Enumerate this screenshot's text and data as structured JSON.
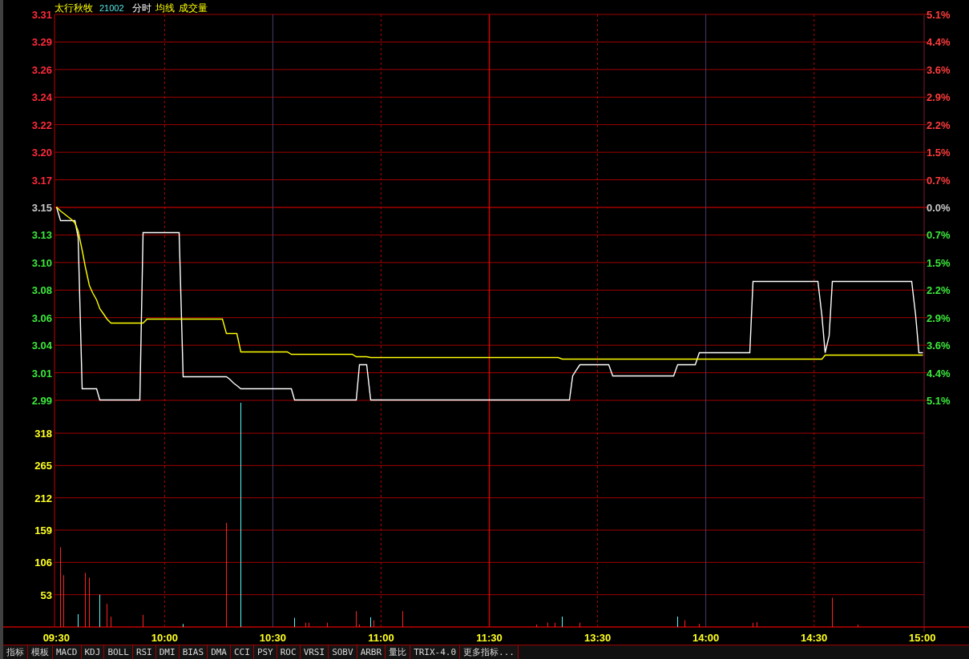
{
  "header": {
    "name": "太行秋牧",
    "code": "21002",
    "volume_label": "成交量"
  },
  "price_chart": {
    "chart_data": {
      "type": "line",
      "ylim": [
        2.99,
        3.31
      ],
      "categories": [
        null,
        null,
        null,
        null,
        null,
        null,
        null,
        null,
        null,
        null,
        null,
        null,
        null,
        null,
        null,
        null,
        null,
        null,
        null,
        null,
        null,
        null,
        null,
        null,
        null,
        null,
        null,
        null,
        null,
        null,
        null,
        null,
        null,
        null,
        null,
        null,
        null,
        null,
        null,
        null,
        null,
        null,
        null,
        null,
        null,
        null,
        null,
        null,
        null,
        null,
        null,
        null,
        null,
        null,
        null,
        null,
        null,
        null,
        null,
        null,
        null,
        null,
        null,
        null,
        null,
        null,
        null,
        null,
        null,
        null,
        null,
        null,
        null,
        null,
        null,
        null,
        null,
        null,
        null,
        null,
        null,
        null,
        null,
        null,
        null,
        null,
        null,
        null,
        null,
        null,
        null,
        null,
        null,
        null,
        null,
        null,
        null,
        null,
        null,
        null,
        null,
        null,
        null,
        null,
        null,
        null,
        null,
        null,
        null,
        null,
        null,
        null,
        null,
        null,
        null,
        null,
        null,
        null,
        null,
        null,
        null,
        null,
        null,
        null,
        null,
        null,
        null,
        null,
        null,
        null,
        null,
        null,
        null,
        null,
        null,
        null,
        null,
        null,
        null,
        null,
        null,
        null,
        null,
        null,
        null,
        null,
        null,
        null,
        null,
        null,
        null,
        null,
        null,
        null,
        null,
        null,
        null,
        null,
        null,
        null,
        null,
        null,
        null,
        null,
        null,
        null,
        null,
        null,
        null,
        null,
        null,
        null,
        null,
        null,
        null,
        null,
        null,
        null,
        null,
        null,
        null,
        null,
        null,
        null,
        null,
        null,
        null,
        null,
        null,
        null,
        null,
        null,
        null,
        null,
        null,
        null,
        null,
        null,
        null,
        null,
        null,
        null,
        null,
        null,
        null,
        null,
        null,
        null,
        null,
        null,
        null,
        null,
        null,
        null,
        null,
        null,
        null,
        null,
        null,
        null,
        null,
        null,
        null,
        null,
        null,
        null,
        null,
        null,
        null,
        null,
        null,
        null,
        null,
        null,
        null,
        null,
        null,
        null,
        null,
        null,
        null
      ],
      "yticks": [
        {
          "value": 3.31,
          "label": "3.31"
        },
        {
          "value": 3.2871,
          "label": "3.29"
        },
        {
          "value": 3.2643,
          "label": "3.26"
        },
        {
          "value": 3.2414,
          "label": "3.24"
        },
        {
          "value": 3.2186,
          "label": "3.22"
        },
        {
          "value": 3.1957,
          "label": "3.20"
        },
        {
          "value": 3.1729,
          "label": "3.17"
        },
        {
          "value": 3.15,
          "label": "3.15"
        },
        {
          "value": 3.1271,
          "label": "3.13"
        },
        {
          "value": 3.1043,
          "label": "3.10"
        },
        {
          "value": 3.0814,
          "label": "3.08"
        },
        {
          "value": 3.0586,
          "label": "3.06"
        },
        {
          "value": 3.0357,
          "label": "3.04"
        },
        {
          "value": 3.0129,
          "label": "3.01"
        },
        {
          "value": 2.99,
          "label": "2.99"
        }
      ],
      "series": [
        {
          "name": "分时",
          "color": "#ffffff",
          "values": [
            3.15,
            3.139,
            3.139,
            3.139,
            3.139,
            3.139,
            3.125,
            2.999,
            2.999,
            2.999,
            2.999,
            2.999,
            2.99,
            2.99,
            2.99,
            2.99,
            2.99,
            2.99,
            2.99,
            2.99,
            2.99,
            2.99,
            2.99,
            2.99,
            3.129,
            3.129,
            3.129,
            3.129,
            3.129,
            3.129,
            3.129,
            3.129,
            3.129,
            3.129,
            3.129,
            3.009,
            3.009,
            3.009,
            3.009,
            3.009,
            3.009,
            3.009,
            3.009,
            3.009,
            3.009,
            3.009,
            3.009,
            3.009,
            3.007,
            3.004,
            3.002,
            2.999,
            2.999,
            2.999,
            2.999,
            2.999,
            2.999,
            2.999,
            2.999,
            2.999,
            2.999,
            2.999,
            2.999,
            2.999,
            2.999,
            2.999,
            2.99,
            2.99,
            2.99,
            2.99,
            2.99,
            2.99,
            2.99,
            2.99,
            2.99,
            2.99,
            2.99,
            2.99,
            2.99,
            2.99,
            2.99,
            2.99,
            2.99,
            2.99,
            3.019,
            3.019,
            3.019,
            2.99,
            2.99,
            2.99,
            2.99,
            2.99,
            2.99,
            2.99,
            2.99,
            2.99,
            2.99,
            2.99,
            2.99,
            2.99,
            2.99,
            2.99,
            2.99,
            2.99,
            2.99,
            2.99,
            2.99,
            2.99,
            2.99,
            2.99,
            2.99,
            2.99,
            2.99,
            2.99,
            2.99,
            2.99,
            2.99,
            2.99,
            2.99,
            2.99,
            2.99,
            2.99,
            2.99,
            2.99,
            2.99,
            2.99,
            2.99,
            2.99,
            2.99,
            2.99,
            2.99,
            2.99,
            2.99,
            2.99,
            2.99,
            2.99,
            2.99,
            2.99,
            2.99,
            2.99,
            2.99,
            2.99,
            2.99,
            3.01,
            3.015,
            3.019,
            3.019,
            3.019,
            3.019,
            3.019,
            3.019,
            3.019,
            3.019,
            3.019,
            3.01,
            3.01,
            3.01,
            3.01,
            3.01,
            3.01,
            3.01,
            3.01,
            3.01,
            3.01,
            3.01,
            3.01,
            3.01,
            3.01,
            3.01,
            3.01,
            3.01,
            3.01,
            3.019,
            3.019,
            3.019,
            3.019,
            3.019,
            3.019,
            3.029,
            3.029,
            3.029,
            3.029,
            3.029,
            3.029,
            3.029,
            3.029,
            3.029,
            3.029,
            3.029,
            3.029,
            3.029,
            3.029,
            3.029,
            3.088,
            3.088,
            3.088,
            3.088,
            3.088,
            3.088,
            3.088,
            3.088,
            3.088,
            3.088,
            3.088,
            3.088,
            3.088,
            3.088,
            3.088,
            3.088,
            3.088,
            3.088,
            3.088,
            3.06,
            3.029,
            3.043,
            3.088,
            3.088,
            3.088,
            3.088,
            3.088,
            3.088,
            3.088,
            3.088,
            3.088,
            3.088,
            3.088,
            3.088,
            3.088,
            3.088,
            3.088,
            3.088,
            3.088,
            3.088,
            3.088,
            3.088,
            3.088,
            3.088,
            3.088,
            3.06,
            3.029,
            3.029
          ]
        },
        {
          "name": "均线",
          "color": "#ffff00",
          "values": [
            3.15,
            3.147,
            3.145,
            3.142,
            3.14,
            3.137,
            3.13,
            3.114,
            3.1,
            3.085,
            3.079,
            3.073,
            3.066,
            3.061,
            3.057,
            3.054,
            3.054,
            3.054,
            3.054,
            3.054,
            3.054,
            3.054,
            3.054,
            3.054,
            3.054,
            3.057,
            3.057,
            3.057,
            3.057,
            3.057,
            3.057,
            3.057,
            3.057,
            3.057,
            3.057,
            3.057,
            3.057,
            3.057,
            3.057,
            3.057,
            3.057,
            3.057,
            3.057,
            3.057,
            3.057,
            3.057,
            3.057,
            3.045,
            3.045,
            3.045,
            3.045,
            3.03,
            3.03,
            3.03,
            3.03,
            3.03,
            3.03,
            3.03,
            3.03,
            3.03,
            3.03,
            3.03,
            3.03,
            3.03,
            3.03,
            3.028,
            3.028,
            3.028,
            3.028,
            3.028,
            3.028,
            3.028,
            3.028,
            3.028,
            3.028,
            3.028,
            3.028,
            3.028,
            3.028,
            3.028,
            3.028,
            3.028,
            3.028,
            3.026,
            3.026,
            3.026,
            3.026,
            3.025,
            3.025,
            3.025,
            3.025,
            3.025,
            3.025,
            3.025,
            3.025,
            3.025,
            3.025,
            3.025,
            3.025,
            3.025,
            3.025,
            3.025,
            3.025,
            3.025,
            3.025,
            3.025,
            3.025,
            3.025,
            3.025,
            3.025,
            3.025,
            3.025,
            3.025,
            3.025,
            3.025,
            3.025,
            3.025,
            3.025,
            3.025,
            3.025,
            3.025,
            3.025,
            3.025,
            3.025,
            3.025,
            3.025,
            3.025,
            3.025,
            3.025,
            3.025,
            3.025,
            3.025,
            3.025,
            3.025,
            3.025,
            3.025,
            3.025,
            3.025,
            3.025,
            3.025,
            3.024,
            3.024,
            3.024,
            3.024,
            3.024,
            3.024,
            3.024,
            3.024,
            3.024,
            3.024,
            3.024,
            3.024,
            3.024,
            3.024,
            3.024,
            3.024,
            3.024,
            3.024,
            3.024,
            3.024,
            3.024,
            3.024,
            3.024,
            3.024,
            3.024,
            3.024,
            3.024,
            3.024,
            3.024,
            3.024,
            3.024,
            3.024,
            3.024,
            3.024,
            3.024,
            3.024,
            3.024,
            3.024,
            3.024,
            3.024,
            3.024,
            3.024,
            3.024,
            3.024,
            3.024,
            3.024,
            3.024,
            3.024,
            3.024,
            3.024,
            3.024,
            3.024,
            3.024,
            3.024,
            3.024,
            3.024,
            3.024,
            3.024,
            3.024,
            3.024,
            3.024,
            3.024,
            3.024,
            3.024,
            3.024,
            3.024,
            3.024,
            3.024,
            3.024,
            3.024,
            3.024,
            3.024,
            3.024,
            3.027,
            3.027,
            3.027,
            3.027,
            3.027,
            3.027,
            3.027,
            3.027,
            3.027,
            3.027,
            3.027,
            3.027,
            3.027,
            3.027,
            3.027,
            3.027,
            3.027,
            3.027,
            3.027,
            3.027,
            3.027,
            3.027,
            3.027,
            3.027,
            3.027,
            3.027,
            3.027,
            3.027
          ]
        }
      ]
    },
    "right_axis": [
      {
        "label": "5.1%",
        "color": "#ff3c3c"
      },
      {
        "label": "4.4%",
        "color": "#ff3c3c"
      },
      {
        "label": "3.6%",
        "color": "#ff3c3c"
      },
      {
        "label": "2.9%",
        "color": "#ff3c3c"
      },
      {
        "label": "2.2%",
        "color": "#ff3c3c"
      },
      {
        "label": "1.5%",
        "color": "#ff3c3c"
      },
      {
        "label": "0.7%",
        "color": "#ff3c3c"
      },
      {
        "label": "0.0%",
        "color": "#c8c8c8"
      },
      {
        "label": "0.7%",
        "color": "#3ce83c"
      },
      {
        "label": "1.5%",
        "color": "#3ce83c"
      },
      {
        "label": "2.2%",
        "color": "#3ce83c"
      },
      {
        "label": "2.9%",
        "color": "#3ce83c"
      },
      {
        "label": "3.6%",
        "color": "#3ce83c"
      },
      {
        "label": "4.4%",
        "color": "#3ce83c"
      },
      {
        "label": "5.1%",
        "color": "#3ce83c"
      }
    ]
  },
  "volume_chart": {
    "chart_data": {
      "type": "bar",
      "ylim": [
        0,
        368
      ],
      "yticks": [
        53,
        106,
        159,
        212,
        265,
        318
      ],
      "categories": [
        "09:30",
        null,
        null,
        null,
        null,
        null,
        null,
        null,
        null,
        null,
        null,
        null,
        null,
        null,
        null,
        null,
        null,
        null,
        null,
        null,
        null,
        null,
        null,
        null,
        null,
        null,
        null,
        null,
        null,
        null,
        "10:00",
        null,
        null,
        null,
        null,
        null,
        null,
        null,
        null,
        null,
        null,
        null,
        null,
        null,
        null,
        null,
        null,
        null,
        null,
        null,
        null,
        null,
        null,
        null,
        null,
        null,
        null,
        null,
        null,
        null,
        "10:30",
        null,
        null,
        null,
        null,
        null,
        null,
        null,
        null,
        null,
        null,
        null,
        null,
        null,
        null,
        null,
        null,
        null,
        null,
        null,
        null,
        null,
        null,
        null,
        null,
        null,
        null,
        null,
        null,
        null,
        "11:00",
        null,
        null,
        null,
        null,
        null,
        null,
        null,
        null,
        null,
        null,
        null,
        null,
        null,
        null,
        null,
        null,
        null,
        null,
        null,
        null,
        null,
        null,
        null,
        null,
        null,
        null,
        null,
        null,
        null,
        "11:30",
        null,
        null,
        null,
        null,
        null,
        null,
        null,
        null,
        null,
        null,
        null,
        null,
        null,
        null,
        null,
        null,
        null,
        null,
        null,
        null,
        null,
        null,
        null,
        null,
        null,
        null,
        null,
        null,
        null,
        "13:30",
        null,
        null,
        null,
        null,
        null,
        null,
        null,
        null,
        null,
        null,
        null,
        null,
        null,
        null,
        null,
        null,
        null,
        null,
        null,
        null,
        null,
        null,
        null,
        null,
        null,
        null,
        null,
        null,
        null,
        "14:00",
        null,
        null,
        null,
        null,
        null,
        null,
        null,
        null,
        null,
        null,
        null,
        null,
        null,
        null,
        null,
        null,
        null,
        null,
        null,
        null,
        null,
        null,
        null,
        null,
        null,
        null,
        null,
        null,
        null,
        "14:30",
        null,
        null,
        null,
        null,
        null,
        null,
        null,
        null,
        null,
        null,
        null,
        null,
        null,
        null,
        null,
        null,
        null,
        null,
        null,
        null,
        null,
        null,
        null,
        null,
        null,
        null,
        null,
        null,
        null,
        "15:00"
      ],
      "series": [
        {
          "color": "#ff2020",
          "values": [
            null,
            131,
            85,
            null,
            null,
            null,
            null,
            null,
            89,
            81,
            null,
            null,
            null,
            null,
            38,
            17,
            null,
            null,
            null,
            null,
            null,
            null,
            null,
            null,
            20,
            null,
            null,
            null,
            null,
            null,
            null,
            null,
            null,
            null,
            null,
            null,
            null,
            null,
            null,
            null,
            null,
            null,
            null,
            null,
            null,
            null,
            null,
            171,
            null,
            null,
            null,
            null,
            null,
            null,
            null,
            null,
            null,
            null,
            null,
            null,
            null,
            null,
            null,
            null,
            null,
            null,
            null,
            null,
            null,
            7,
            7,
            null,
            null,
            null,
            null,
            7,
            null,
            null,
            null,
            null,
            null,
            null,
            null,
            26,
            4,
            null,
            null,
            null,
            11,
            null,
            null,
            null,
            null,
            null,
            null,
            null,
            26,
            null,
            null,
            null,
            null,
            null,
            null,
            null,
            null,
            null,
            null,
            null,
            null,
            null,
            null,
            null,
            null,
            null,
            null,
            null,
            null,
            null,
            null,
            null,
            null,
            null,
            null,
            null,
            null,
            null,
            null,
            null,
            null,
            null,
            null,
            null,
            null,
            4,
            null,
            null,
            7,
            null,
            7,
            null,
            null,
            null,
            null,
            null,
            null,
            7,
            null,
            null,
            null,
            null,
            null,
            null,
            null,
            null,
            null,
            null,
            null,
            null,
            null,
            null,
            null,
            null,
            null,
            null,
            null,
            null,
            null,
            null,
            null,
            null,
            null,
            null,
            null,
            null,
            11,
            null,
            null,
            null,
            5,
            null,
            null,
            null,
            null,
            null,
            null,
            null,
            null,
            null,
            null,
            null,
            null,
            null,
            null,
            7,
            8,
            null,
            null,
            null,
            null,
            null,
            null,
            null,
            null,
            null,
            null,
            null,
            null,
            null,
            null,
            null,
            null,
            null,
            null,
            null,
            null,
            48,
            null,
            null,
            null,
            null,
            null,
            null,
            4,
            null,
            null,
            null,
            null,
            null,
            null,
            null,
            null,
            null,
            null,
            null,
            null,
            null,
            null,
            null,
            null,
            null,
            null
          ]
        },
        {
          "color": "#54fcfc",
          "values": [
            null,
            null,
            null,
            null,
            null,
            null,
            21,
            null,
            null,
            null,
            null,
            null,
            53,
            null,
            null,
            null,
            null,
            null,
            null,
            null,
            null,
            null,
            null,
            null,
            null,
            null,
            null,
            null,
            null,
            null,
            null,
            null,
            null,
            null,
            null,
            5,
            null,
            null,
            null,
            null,
            null,
            null,
            null,
            null,
            null,
            null,
            null,
            null,
            null,
            null,
            null,
            368,
            null,
            null,
            null,
            null,
            null,
            null,
            null,
            null,
            null,
            null,
            null,
            null,
            null,
            null,
            15,
            null,
            null,
            null,
            null,
            null,
            null,
            null,
            null,
            null,
            null,
            null,
            null,
            null,
            null,
            null,
            null,
            null,
            null,
            null,
            null,
            16,
            null,
            null,
            null,
            null,
            null,
            null,
            null,
            null,
            null,
            null,
            null,
            null,
            null,
            null,
            null,
            null,
            null,
            null,
            null,
            null,
            null,
            null,
            null,
            null,
            null,
            null,
            null,
            null,
            null,
            null,
            null,
            null,
            null,
            null,
            null,
            null,
            null,
            null,
            null,
            null,
            null,
            null,
            null,
            null,
            null,
            null,
            null,
            null,
            null,
            null,
            null,
            null,
            17,
            null,
            null,
            null,
            null,
            null,
            null,
            null,
            null,
            null,
            null,
            null,
            null,
            null,
            null,
            null,
            null,
            null,
            null,
            null,
            null,
            null,
            null,
            null,
            null,
            null,
            null,
            null,
            null,
            null,
            null,
            null,
            17,
            null,
            null,
            null,
            null,
            null,
            null,
            null,
            null,
            null,
            null,
            null,
            null,
            null,
            null,
            null,
            null,
            null,
            null,
            null,
            null,
            null,
            null,
            null,
            null,
            null,
            null,
            null,
            null,
            null,
            null,
            null,
            null,
            null,
            null,
            null,
            null,
            null,
            null,
            null,
            null,
            null,
            null,
            null,
            null,
            null,
            null,
            null,
            null,
            null,
            null,
            null,
            null,
            null,
            null,
            null,
            null,
            null,
            null,
            null,
            null,
            null,
            null,
            null,
            null,
            null,
            null,
            null,
            null
          ]
        }
      ]
    }
  },
  "indicator_tabs": [
    "指标",
    "模板",
    "MACD",
    "KDJ",
    "BOLL",
    "RSI",
    "DMI",
    "BIAS",
    "DMA",
    "CCI",
    "PSY",
    "ROC",
    "VRSI",
    "SOBV",
    "ARBR",
    "量比",
    "TRIX-4.0",
    "更多指标..."
  ]
}
